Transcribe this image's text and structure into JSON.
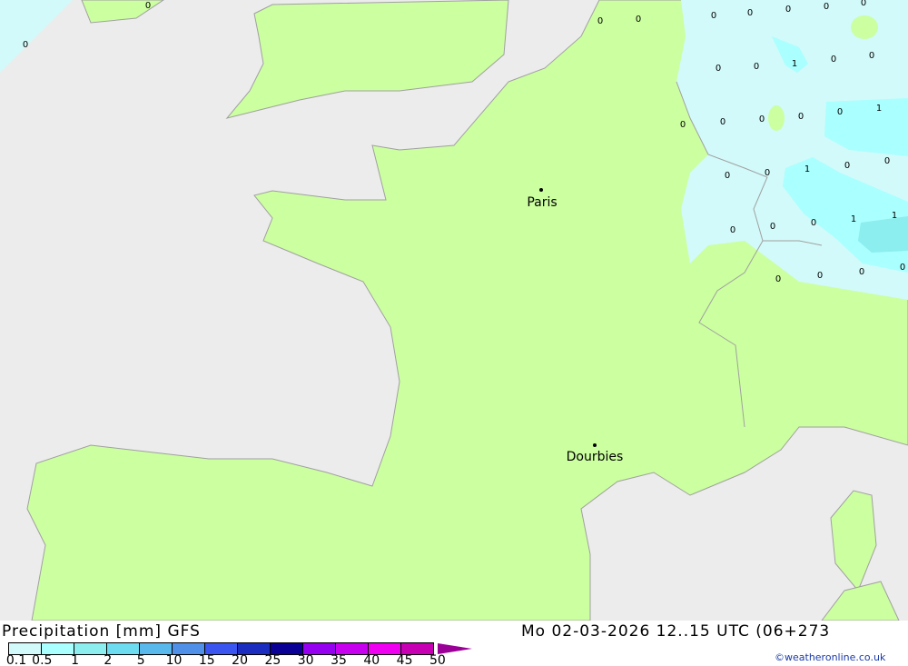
{
  "map": {
    "colors": {
      "sea": "#ececec",
      "land": "#ccffa0",
      "p01": "#d2fafa",
      "p05": "#aaffff",
      "p1": "#8ceeee",
      "border": "#a0a0a0"
    },
    "cities": [
      {
        "name": "Paris"
      },
      {
        "name": "Dourbies"
      }
    ],
    "values": [
      "0",
      "0",
      "0",
      "0",
      "0",
      "0",
      "0",
      "0",
      "0",
      "0",
      "0",
      "1",
      "0",
      "0",
      "0",
      "0",
      "0",
      "0",
      "0",
      "1",
      "0",
      "0",
      "1",
      "0",
      "0",
      "0",
      "0",
      "0",
      "1",
      "1",
      "0",
      "0",
      "0",
      "0"
    ]
  },
  "footer": {
    "title": "Precipitation [mm] GFS",
    "datetime": "Mo 02-03-2026 12..15 UTC (06+273",
    "copyright": "©weatheronline.co.uk",
    "legend": {
      "ticks": [
        "0.1",
        "0.5",
        "1",
        "2",
        "5",
        "10",
        "15",
        "20",
        "25",
        "30",
        "35",
        "40",
        "45",
        "50"
      ],
      "colors": [
        "#d2fafa",
        "#aaffff",
        "#8ceeee",
        "#6edcf0",
        "#5ab9ec",
        "#5090e8",
        "#3a55f0",
        "#1a2dbe",
        "#0a0096",
        "#9600f0",
        "#c800f0",
        "#f000f0",
        "#c800b4"
      ]
    }
  }
}
